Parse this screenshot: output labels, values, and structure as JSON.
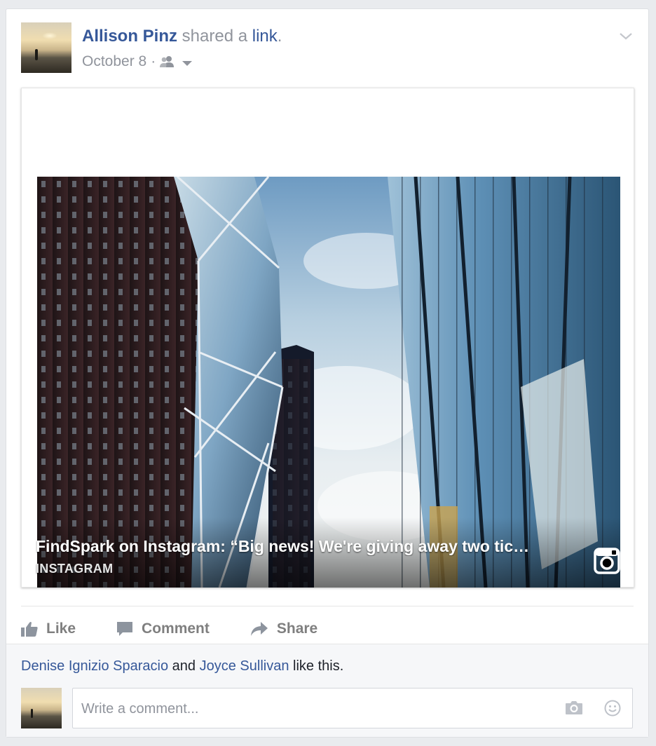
{
  "post": {
    "author": "Allison Pinz",
    "action_prefix": " shared a ",
    "action_link": "link",
    "action_suffix": ".",
    "date": "October 8",
    "separator": "·",
    "audience_icon": "friends-icon",
    "menu_icon": "chevron-down-icon"
  },
  "link_preview": {
    "title": "FindSpark on Instagram: “Big news! We're giving away two tic…",
    "source": "INSTAGRAM",
    "source_icon": "instagram-icon"
  },
  "actions": [
    {
      "label": "Like",
      "icon": "thumbs-up-icon"
    },
    {
      "label": "Comment",
      "icon": "comment-bubble-icon"
    },
    {
      "label": "Share",
      "icon": "share-arrow-icon"
    }
  ],
  "likes": {
    "name1": "Denise Ignizio Sparacio",
    "joiner": " and ",
    "name2": "Joyce Sullivan",
    "suffix": " like this."
  },
  "comment": {
    "placeholder": "Write a comment...",
    "camera_icon": "camera-icon",
    "emoji_icon": "smiley-icon"
  },
  "colors": {
    "link_blue": "#365899",
    "meta_gray": "#90949c",
    "action_gray": "#7f7f7f",
    "page_bg": "#e9ebee"
  }
}
